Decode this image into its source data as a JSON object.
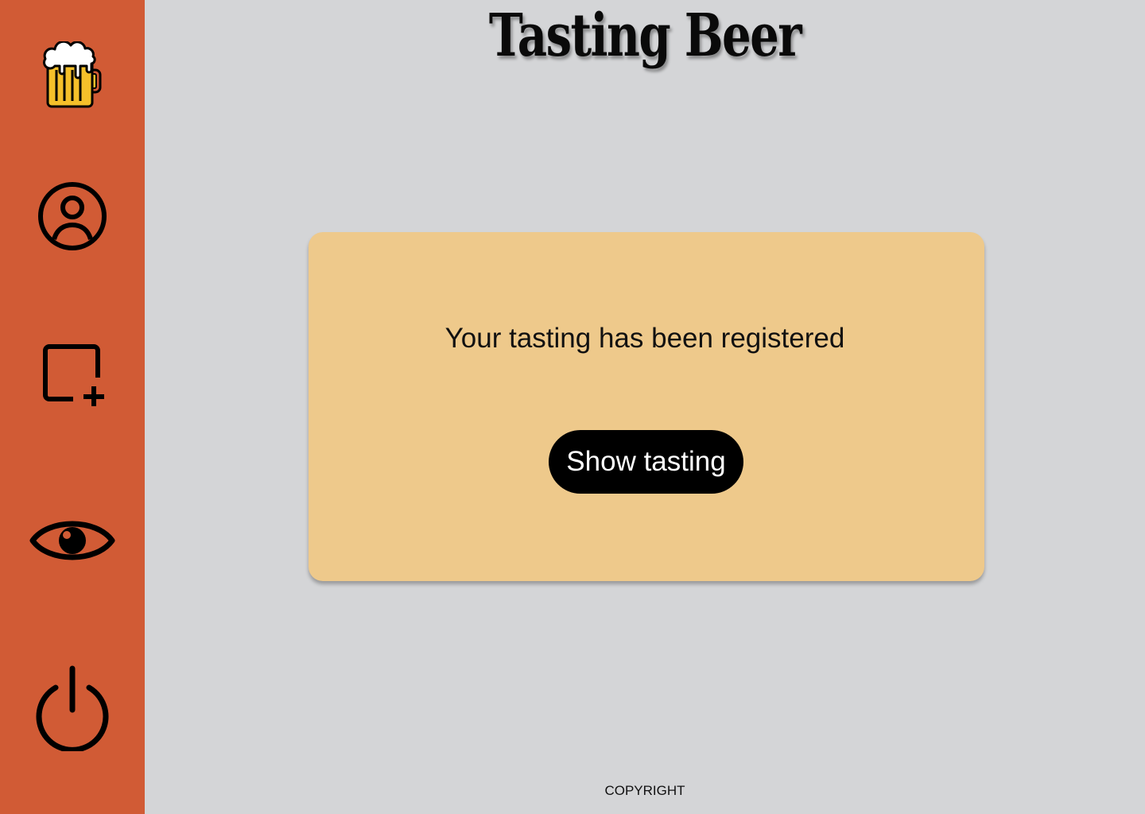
{
  "header": {
    "title": "Tasting Beer"
  },
  "sidebar": {
    "items": [
      {
        "icon": "beer-mug-icon"
      },
      {
        "icon": "user-profile-icon"
      },
      {
        "icon": "add-square-icon"
      },
      {
        "icon": "eye-icon"
      },
      {
        "icon": "power-icon"
      }
    ]
  },
  "card": {
    "message": "Your tasting has been registered",
    "button_label": "Show tasting"
  },
  "footer": {
    "text": "COPYRIGHT"
  },
  "colors": {
    "sidebar": "#d15b35",
    "background": "#d4d5d7",
    "card": "#eec98b",
    "button": "#000000",
    "beer": "#f5c02a"
  }
}
